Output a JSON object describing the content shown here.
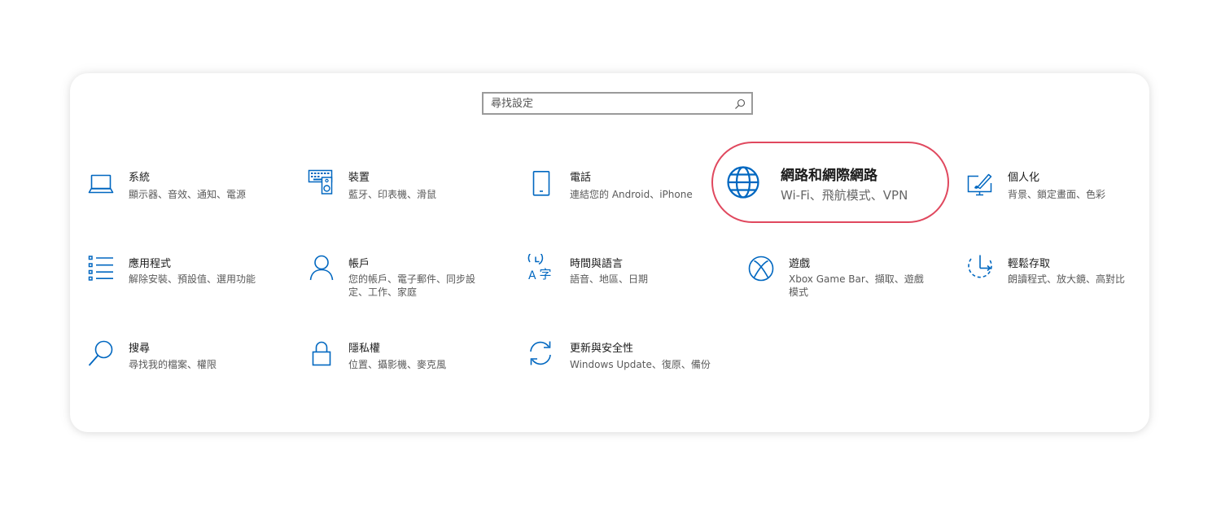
{
  "search": {
    "placeholder": "尋找設定"
  },
  "accent_color": "#0067c0",
  "highlight_color": "#e0485e",
  "tiles": [
    {
      "icon": "laptop-icon",
      "title": "系統",
      "desc": "顯示器、音效、通知、電源"
    },
    {
      "icon": "keyboard-speaker-icon",
      "title": "裝置",
      "desc": "藍牙、印表機、滑鼠"
    },
    {
      "icon": "phone-icon",
      "title": "電話",
      "desc": "連結您的 Android、iPhone"
    },
    {
      "icon": "globe-icon",
      "title": "網路和網際網路",
      "desc": "Wi-Fi、飛航模式、VPN"
    },
    {
      "icon": "paint-brush-icon",
      "title": "個人化",
      "desc": "背景、鎖定畫面、色彩"
    },
    {
      "icon": "list-icon",
      "title": "應用程式",
      "desc": "解除安裝、預設值、選用功能"
    },
    {
      "icon": "person-icon",
      "title": "帳戶",
      "desc": "您的帳戶、電子郵件、同步設定、工作、家庭"
    },
    {
      "icon": "language-icon",
      "title": "時間與語言",
      "desc": "語音、地區、日期"
    },
    {
      "icon": "xbox-icon",
      "title": "遊戲",
      "desc": "Xbox Game Bar、擷取、遊戲模式"
    },
    {
      "icon": "ease-of-access-icon",
      "title": "輕鬆存取",
      "desc": "朗讀程式、放大鏡、高對比"
    },
    {
      "icon": "search-magnifier-icon",
      "title": "搜尋",
      "desc": "尋找我的檔案、權限"
    },
    {
      "icon": "lock-icon",
      "title": "隱私權",
      "desc": "位置、攝影機、麥克風"
    },
    {
      "icon": "update-icon",
      "title": "更新與安全性",
      "desc": "Windows Update、復原、備份"
    }
  ]
}
